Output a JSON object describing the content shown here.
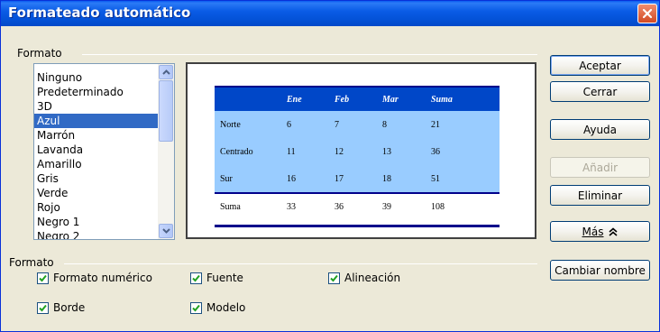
{
  "window": {
    "title": "Formateado automático",
    "close_icon": "close-icon"
  },
  "groups": {
    "formato_top": "Formato",
    "formato_bottom": "Formato"
  },
  "list": {
    "items": [
      "Ninguno",
      "Predeterminado",
      "3D",
      "Azul",
      "Marrón",
      "Lavanda",
      "Amarillo",
      "Gris",
      "Verde",
      "Rojo",
      "Negro 1",
      "Negro 2"
    ],
    "selected": "Azul"
  },
  "preview": {
    "header": [
      "",
      "Ene",
      "Feb",
      "Mar",
      "Suma"
    ],
    "rows": [
      [
        "Norte",
        "6",
        "7",
        "8",
        "21"
      ],
      [
        "Centrado",
        "11",
        "12",
        "13",
        "36"
      ],
      [
        "Sur",
        "16",
        "17",
        "18",
        "51"
      ]
    ],
    "total": [
      "Suma",
      "33",
      "36",
      "39",
      "108"
    ],
    "colors": {
      "header_bg": "#0047c8",
      "body_bg": "#99ccff",
      "rule": "#00008b"
    }
  },
  "buttons": {
    "aceptar": "Aceptar",
    "cerrar": "Cerrar",
    "ayuda": "Ayuda",
    "anadir": "Añadir",
    "eliminar": "Eliminar",
    "mas": "Más",
    "cambiar_nombre": "Cambiar nombre"
  },
  "options": {
    "formato_numerico": {
      "label": "Formato numérico",
      "checked": true
    },
    "fuente": {
      "label": "Fuente",
      "checked": true
    },
    "alineacion": {
      "label": "Alineación",
      "checked": true
    },
    "borde": {
      "label": "Borde",
      "checked": true
    },
    "modelo": {
      "label": "Modelo",
      "checked": true
    }
  }
}
